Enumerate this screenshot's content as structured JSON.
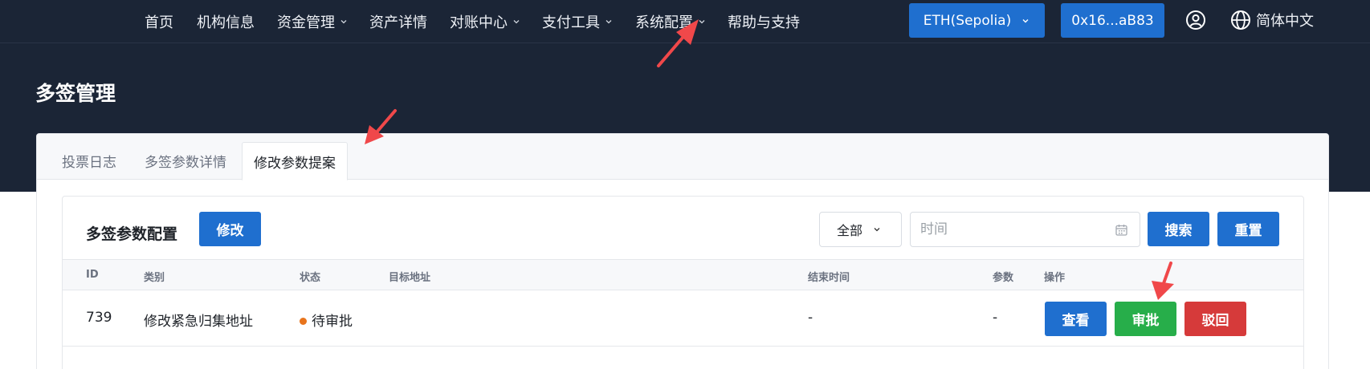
{
  "nav": {
    "items": [
      {
        "label": "首页",
        "dropdown": false
      },
      {
        "label": "机构信息",
        "dropdown": false
      },
      {
        "label": "资金管理",
        "dropdown": true
      },
      {
        "label": "资产详情",
        "dropdown": false
      },
      {
        "label": "对账中心",
        "dropdown": true
      },
      {
        "label": "支付工具",
        "dropdown": true
      },
      {
        "label": "系统配置",
        "dropdown": true
      },
      {
        "label": "帮助与支持",
        "dropdown": false
      }
    ],
    "network_label": "ETH(Sepolia)",
    "wallet_label": "0x16...aB83",
    "language_label": "简体中文",
    "icons": [
      "user-circle-icon",
      "globe-icon",
      "chevron-down-icon"
    ]
  },
  "page": {
    "title": "多签管理"
  },
  "tabs": [
    {
      "label": "投票日志",
      "active": false
    },
    {
      "label": "多签参数详情",
      "active": false
    },
    {
      "label": "修改参数提案",
      "active": true
    }
  ],
  "section": {
    "title": "多签参数配置",
    "edit_label": "修改",
    "filter": {
      "status_value": "全部",
      "time_placeholder": "时间",
      "search_label": "搜索",
      "reset_label": "重置"
    }
  },
  "table": {
    "headers": [
      "ID",
      "类别",
      "状态",
      "目标地址",
      "结束时间",
      "参数",
      "操作"
    ],
    "rows": [
      {
        "id": "739",
        "category": "修改紧急归集地址",
        "status": "待审批",
        "status_color": "#e8741c",
        "target": "",
        "end_time": "-",
        "params": "-",
        "actions": {
          "view": "查看",
          "approve": "审批",
          "reject": "驳回"
        }
      }
    ]
  },
  "colors": {
    "nav_bg": "#1b2536",
    "primary": "#1f6fcf",
    "success": "#27ae4a",
    "danger": "#d63a3a",
    "annotation": "#f0484a"
  }
}
